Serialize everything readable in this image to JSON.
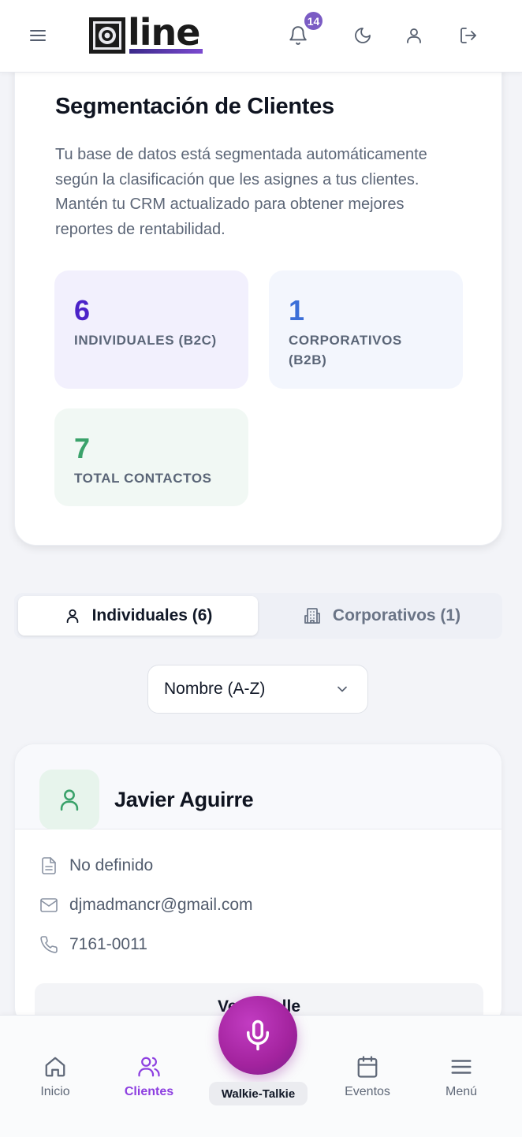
{
  "header": {
    "logo_text": "line",
    "notification_count": "14"
  },
  "segmentation": {
    "title": "Segmentación de Clientes",
    "description": "Tu base de datos está segmentada automáticamente según la clasificación que les asignes a tus clientes. Mantén tu CRM actualizado para obtener mejores reportes de rentabilidad.",
    "stats": [
      {
        "value": "6",
        "label": "INDIVIDUALES (B2C)",
        "color": "#4b22c8"
      },
      {
        "value": "1",
        "label": "CORPORATIVOS (B2B)",
        "color": "#3c6fd8"
      },
      {
        "value": "7",
        "label": "TOTAL CONTACTOS",
        "color": "#3aa26a"
      }
    ]
  },
  "tabs": [
    {
      "label": "Individuales (6)",
      "active": true
    },
    {
      "label": "Corporativos (1)",
      "active": false
    }
  ],
  "sort": {
    "selected": "Nombre (A-Z)"
  },
  "client": {
    "name": "Javier Aguirre",
    "document": "No definido",
    "email": "djmadmancr@gmail.com",
    "phone": "7161-0011",
    "detail_button": "Ver detalle"
  },
  "bottom_nav": {
    "items": [
      {
        "label": "Inicio",
        "icon": "home-icon"
      },
      {
        "label": "Clientes",
        "icon": "users-icon",
        "active": true
      },
      {
        "label": "Walkie-Talkie",
        "icon": "mic-icon"
      },
      {
        "label": "Eventos",
        "icon": "calendar-icon"
      },
      {
        "label": "Menú",
        "icon": "menu-icon"
      }
    ]
  },
  "colors": {
    "accent": "#8d3fe0",
    "mic": "#a3239e"
  }
}
